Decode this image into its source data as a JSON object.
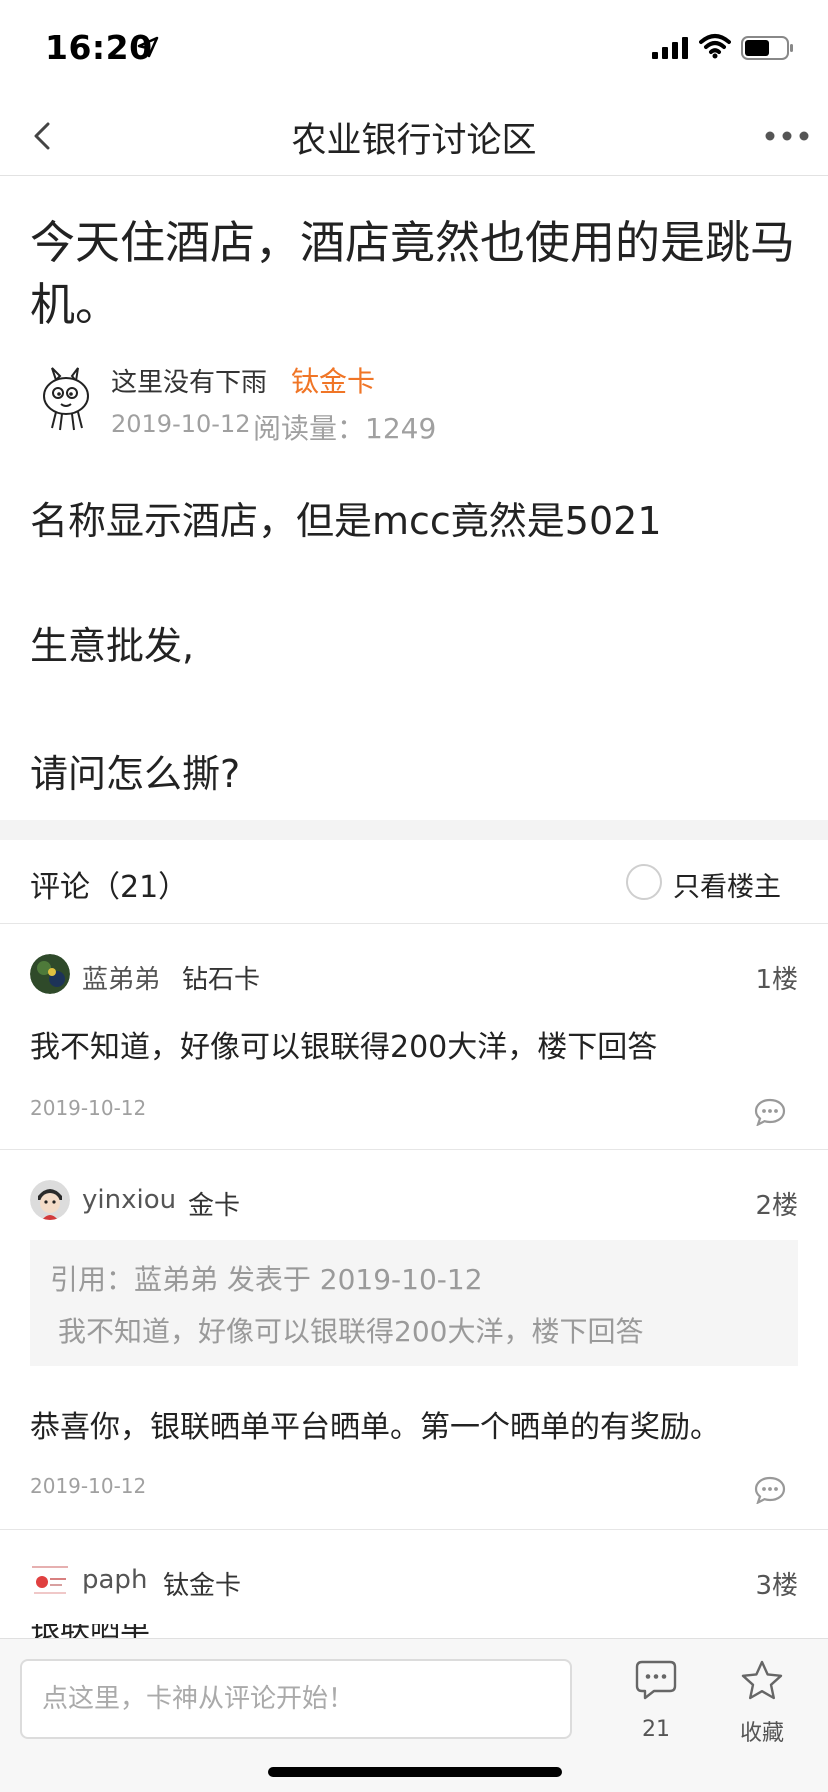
{
  "status_bar": {
    "time": "16:20"
  },
  "nav": {
    "title": "农业银行讨论区"
  },
  "post": {
    "title": "今天住酒店，酒店竟然也使用的是跳马机。",
    "author": {
      "name": "这里没有下雨",
      "badge": "钛金卡"
    },
    "date": "2019-10-12",
    "reads": "阅读量：1249",
    "body": [
      "名称显示酒店，但是mcc竟然是5021",
      "生意批发,",
      "请问怎么撕?"
    ]
  },
  "comments_header": {
    "title": "评论（21）",
    "op_only_label": "只看楼主"
  },
  "comments": [
    {
      "name": "蓝弟弟",
      "badge": "钻石卡",
      "floor": "1楼",
      "text": "我不知道，好像可以银联得200大洋，楼下回答",
      "date": "2019-10-12"
    },
    {
      "name": "yinxiou",
      "badge": "金卡",
      "floor": "2楼",
      "quote": {
        "header": "引用：蓝弟弟 发表于 2019-10-12",
        "text": "我不知道，好像可以银联得200大洋，楼下回答"
      },
      "text": "恭喜你，银联晒单平台晒单。第一个晒单的有奖励。",
      "date": "2019-10-12"
    },
    {
      "name": "paph",
      "badge": "钛金卡",
      "floor": "3楼",
      "text": "银联晒单"
    }
  ],
  "bottom_bar": {
    "input_placeholder": "点这里，卡神从评论开始！",
    "comment_count": "21",
    "favorite_label": "收藏"
  },
  "colors": {
    "accent": "#f07526",
    "divider": "#e6e6e6",
    "muted_text": "#a0a0a0"
  }
}
